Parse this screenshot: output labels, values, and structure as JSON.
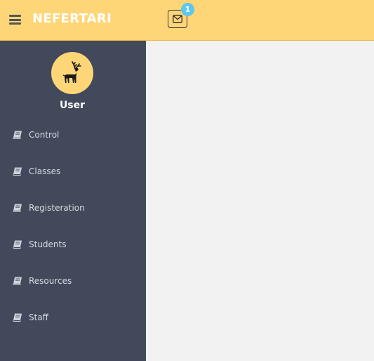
{
  "header": {
    "brand": "NEFERTARI",
    "menu_icon": "hamburger-icon",
    "mail_icon": "envelope-icon",
    "notification_count": "1",
    "colors": {
      "bar": "#ffd677",
      "badge": "#5bc8ef"
    }
  },
  "sidebar": {
    "avatar_icon": "deer-icon",
    "user_name": "User",
    "items": [
      {
        "label": "Control",
        "icon": "book-icon"
      },
      {
        "label": "Classes",
        "icon": "book-icon"
      },
      {
        "label": "Registeration",
        "icon": "book-icon"
      },
      {
        "label": "Students",
        "icon": "book-icon"
      },
      {
        "label": "Resources",
        "icon": "book-icon"
      },
      {
        "label": "Staff",
        "icon": "book-icon"
      }
    ],
    "colors": {
      "background": "#41495b"
    }
  }
}
